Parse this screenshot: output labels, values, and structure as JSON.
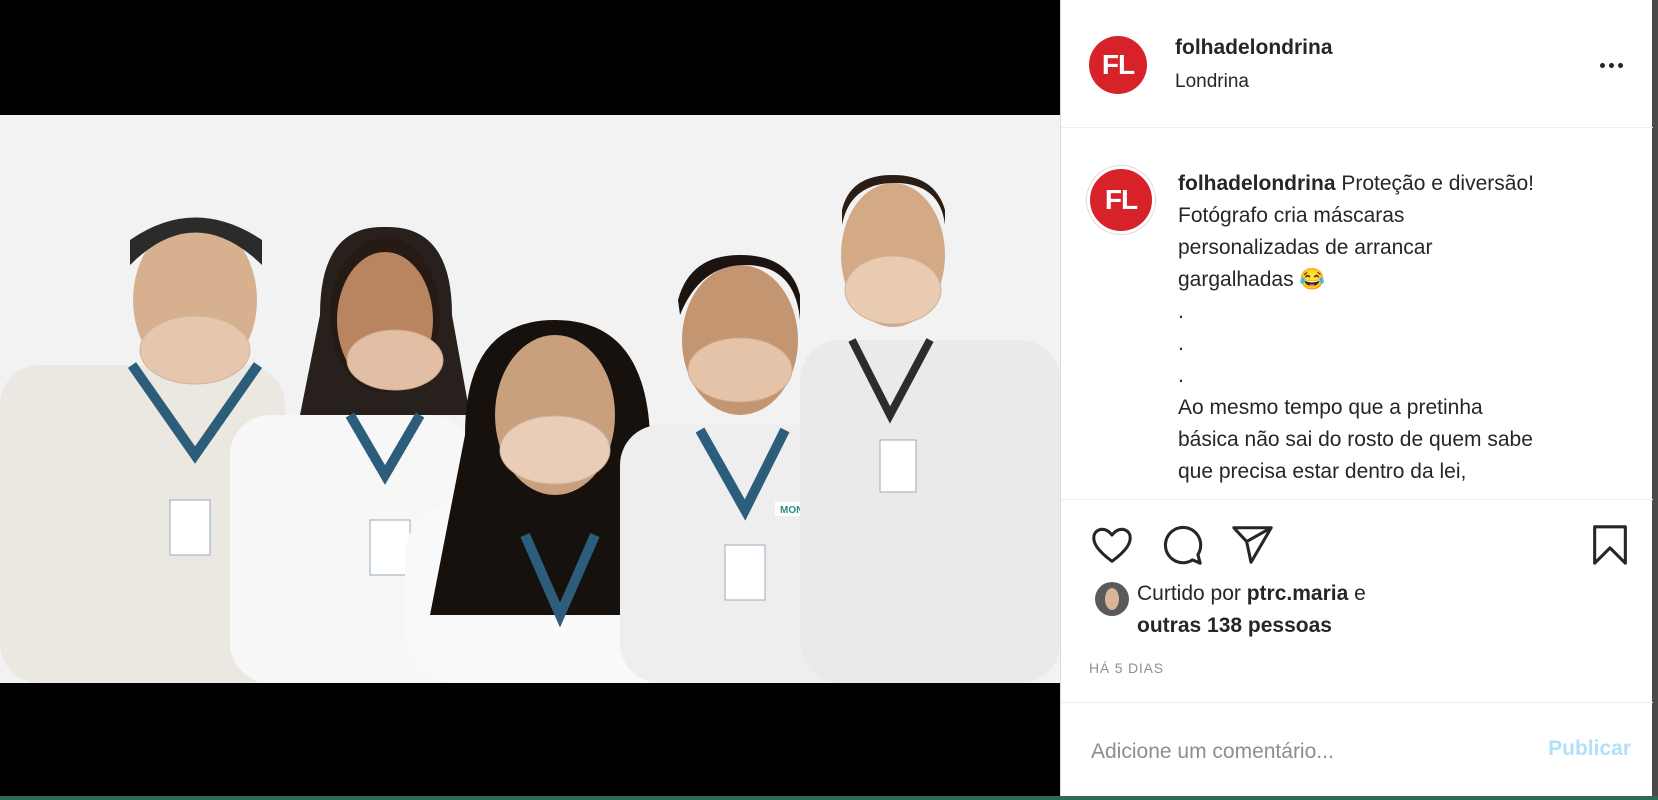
{
  "post": {
    "username": "folhadelondrina",
    "location": "Londrina",
    "avatar_text": "FL",
    "brand_color": "#d8222a"
  },
  "caption": {
    "username": "folhadelondrina",
    "lines": [
      "Proteção e diversão!",
      "Fotógrafo cria máscaras",
      "personalizadas de arrancar",
      "gargalhadas 😂",
      ".",
      ".",
      ".",
      "Ao mesmo tempo que a pretinha",
      "básica não sai do rosto de quem sabe",
      "que precisa estar dentro da lei,"
    ]
  },
  "likes": {
    "prefix": "Curtido por ",
    "liker": "ptrc.maria",
    "conjunction": " e",
    "others": "outras 138 pessoas"
  },
  "timestamp": "HÁ 5 DIAS",
  "comment": {
    "placeholder": "Adicione um comentário...",
    "publish_label": "Publicar"
  },
  "photo": {
    "badge_logo": "MONACA"
  },
  "icons": [
    "heart-icon",
    "comment-icon",
    "share-icon",
    "bookmark-icon",
    "more-options-icon"
  ]
}
